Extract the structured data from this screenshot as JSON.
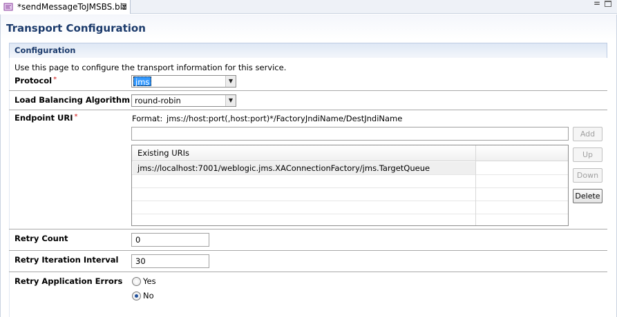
{
  "tab": {
    "title": "*sendMessageToJMSBS.biz",
    "icon": "proxy-service-file-icon",
    "close": "⊠"
  },
  "window_controls": {
    "minimize": "=",
    "maximize": "□"
  },
  "form": {
    "title": "Transport Configuration",
    "section": "Configuration",
    "description": "Use this page to configure the transport information for this service."
  },
  "protocol": {
    "label": "Protocol",
    "required": "*",
    "value": "jms"
  },
  "load_balancing": {
    "label": "Load Balancing Algorithm",
    "value": "round-robin"
  },
  "endpoint": {
    "label": "Endpoint URI",
    "required": "*",
    "format_label": "Format:",
    "format_value": "jms://host:port(,host:port)*/FactoryJndiName/DestJndiName",
    "input_value": "",
    "buttons": {
      "add": "Add",
      "up": "Up",
      "down": "Down",
      "delete": "Delete"
    },
    "table": {
      "header": "Existing URIs",
      "rows": [
        "jms://localhost:7001/weblogic.jms.XAConnectionFactory/jms.TargetQueue",
        "",
        "",
        "",
        ""
      ]
    }
  },
  "retry_count": {
    "label": "Retry Count",
    "value": "0"
  },
  "retry_interval": {
    "label": "Retry Iteration Interval",
    "value": "30"
  },
  "retry_app_errors": {
    "label": "Retry Application Errors",
    "options": [
      "Yes",
      "No"
    ],
    "selected": "No"
  },
  "colors": {
    "title": "#1b3a6b",
    "required": "#d01010",
    "selection": "#3399ff"
  }
}
